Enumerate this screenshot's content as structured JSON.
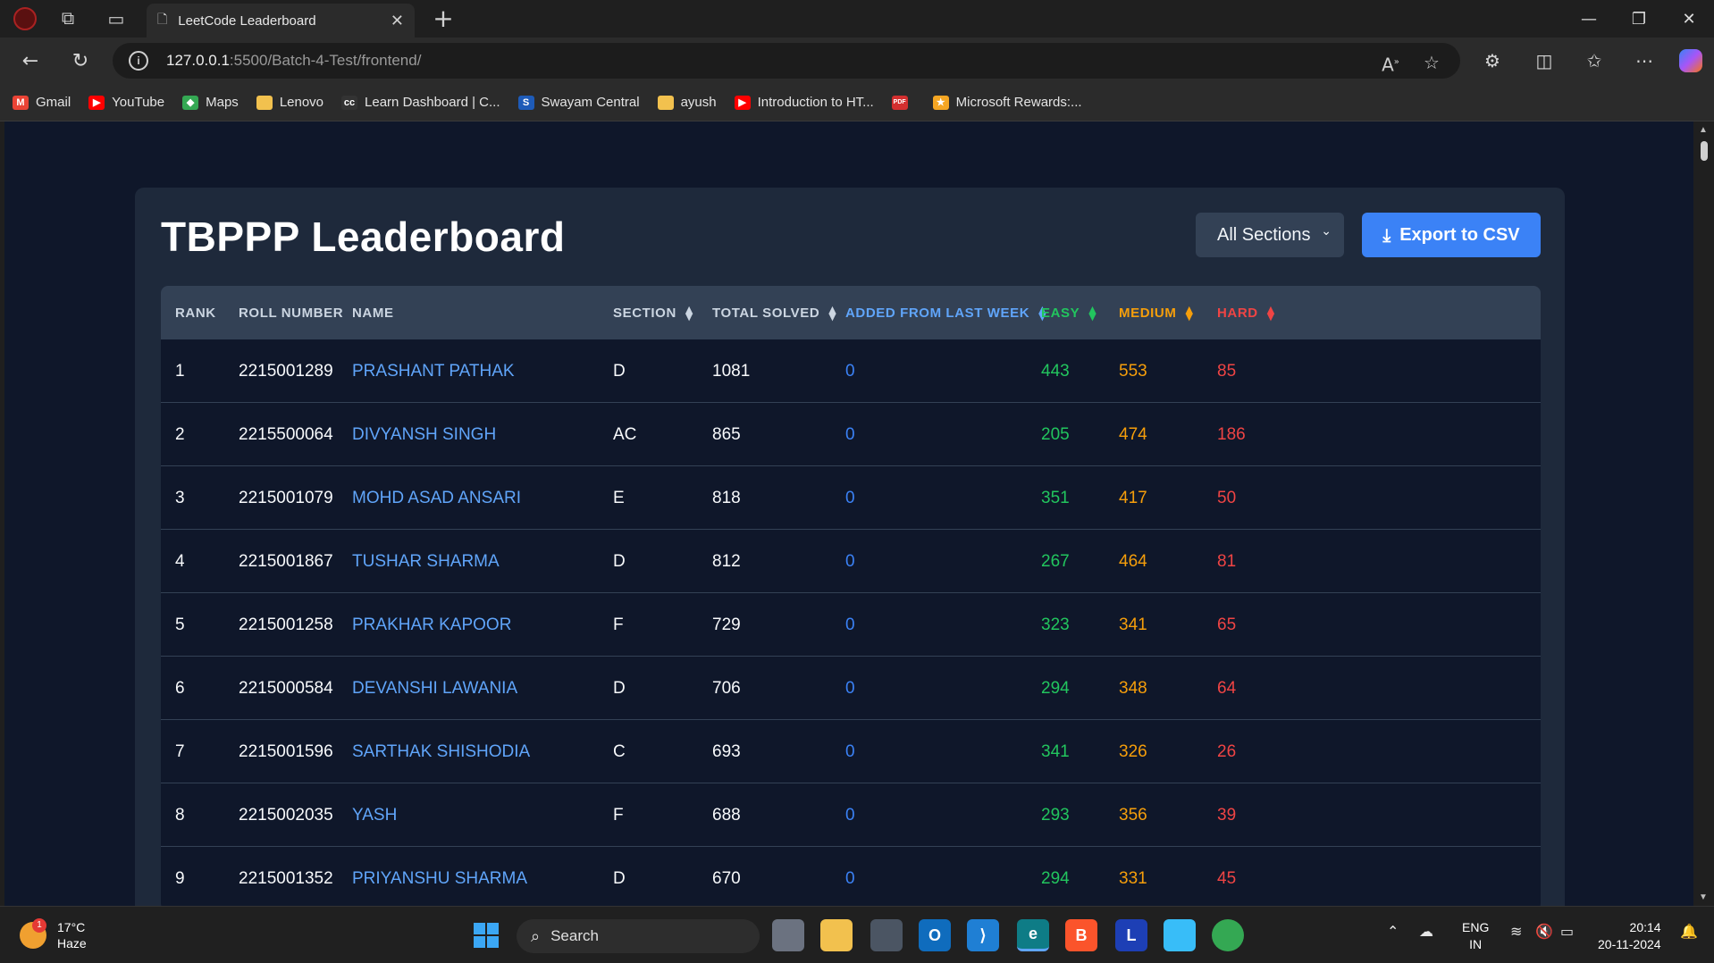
{
  "browser": {
    "tab_title": "LeetCode Leaderboard",
    "url_host": "127.0.0.1",
    "url_path": ":5500/Batch-4-Test/frontend/",
    "bookmarks": [
      {
        "label": "Gmail",
        "icon": "gmail-icon",
        "color": "#ea4335"
      },
      {
        "label": "YouTube",
        "icon": "youtube-icon",
        "color": "#ff0000"
      },
      {
        "label": "Maps",
        "icon": "maps-icon",
        "color": "#34a853"
      },
      {
        "label": "Lenovo",
        "icon": "folder-icon",
        "color": "#f2c14e"
      },
      {
        "label": "Learn Dashboard | C...",
        "icon": "cc-icon",
        "color": "#333333"
      },
      {
        "label": "Swayam Central",
        "icon": "swayam-icon",
        "color": "#1e5bb8"
      },
      {
        "label": "ayush",
        "icon": "folder-icon",
        "color": "#f2c14e"
      },
      {
        "label": "Introduction to HT...",
        "icon": "youtube-icon",
        "color": "#ff0000"
      },
      {
        "label": "",
        "icon": "pdf-icon",
        "color": "#d32f2f"
      },
      {
        "label": "Microsoft Rewards:...",
        "icon": "rewards-icon",
        "color": "#f5a623"
      }
    ]
  },
  "page": {
    "title": "TBPPP Leaderboard",
    "section_select": "All Sections",
    "export_label": "Export to CSV",
    "columns": {
      "rank": "RANK",
      "roll": "ROLL NUMBER",
      "name": "NAME",
      "section": "SECTION",
      "total": "TOTAL SOLVED",
      "added": "ADDED FROM LAST WEEK",
      "easy": "EASY",
      "medium": "MEDIUM",
      "hard": "HARD"
    },
    "rows": [
      {
        "rank": "1",
        "roll": "2215001289",
        "name": "PRASHANT PATHAK",
        "section": "D",
        "total": "1081",
        "added": "0",
        "easy": "443",
        "medium": "553",
        "hard": "85"
      },
      {
        "rank": "2",
        "roll": "2215500064",
        "name": "DIVYANSH SINGH",
        "section": "AC",
        "total": "865",
        "added": "0",
        "easy": "205",
        "medium": "474",
        "hard": "186"
      },
      {
        "rank": "3",
        "roll": "2215001079",
        "name": "MOHD ASAD ANSARI",
        "section": "E",
        "total": "818",
        "added": "0",
        "easy": "351",
        "medium": "417",
        "hard": "50"
      },
      {
        "rank": "4",
        "roll": "2215001867",
        "name": "TUSHAR SHARMA",
        "section": "D",
        "total": "812",
        "added": "0",
        "easy": "267",
        "medium": "464",
        "hard": "81"
      },
      {
        "rank": "5",
        "roll": "2215001258",
        "name": "PRAKHAR KAPOOR",
        "section": "F",
        "total": "729",
        "added": "0",
        "easy": "323",
        "medium": "341",
        "hard": "65"
      },
      {
        "rank": "6",
        "roll": "2215000584",
        "name": "DEVANSHI LAWANIA",
        "section": "D",
        "total": "706",
        "added": "0",
        "easy": "294",
        "medium": "348",
        "hard": "64"
      },
      {
        "rank": "7",
        "roll": "2215001596",
        "name": "SARTHAK SHISHODIA",
        "section": "C",
        "total": "693",
        "added": "0",
        "easy": "341",
        "medium": "326",
        "hard": "26"
      },
      {
        "rank": "8",
        "roll": "2215002035",
        "name": "YASH",
        "section": "F",
        "total": "688",
        "added": "0",
        "easy": "293",
        "medium": "356",
        "hard": "39"
      },
      {
        "rank": "9",
        "roll": "2215001352",
        "name": "PRIYANSHU SHARMA",
        "section": "D",
        "total": "670",
        "added": "0",
        "easy": "294",
        "medium": "331",
        "hard": "45"
      }
    ]
  },
  "colors": {
    "background": "#0f172a",
    "card": "#1e293b",
    "header": "#334155",
    "accent_blue": "#3b82f6",
    "name_link": "#60a5fa",
    "easy": "#22c55e",
    "medium": "#f59e0b",
    "hard": "#ef4444"
  },
  "taskbar": {
    "weather_temp": "17°C",
    "weather_desc": "Haze",
    "weather_badge": "1",
    "search_label": "Search",
    "lang_line1": "ENG",
    "lang_line2": "IN",
    "time": "20:14",
    "date": "20-11-2024"
  }
}
